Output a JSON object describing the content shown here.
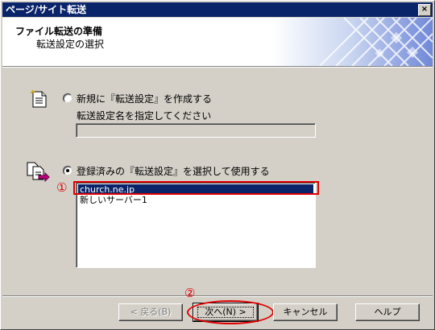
{
  "window": {
    "title": "ページ/サイト転送",
    "close_glyph": "×"
  },
  "header": {
    "title": "ファイル転送の準備",
    "subtitle": "転送設定の選択"
  },
  "option_new": {
    "label": "新規に『転送設定』を作成する",
    "field_label": "転送設定名を指定してください",
    "field_value": ""
  },
  "option_existing": {
    "label": "登録済みの『転送設定』を選択して使用する",
    "selected": true
  },
  "list": {
    "items": [
      "church.ne.jp",
      "新しいサーバー1"
    ],
    "selected_index": 0
  },
  "annotations": {
    "marker1": "①",
    "marker2": "②",
    "color": "#e00000"
  },
  "buttons": {
    "back": "< 戻る(B)",
    "next": "次へ(N) >",
    "cancel": "キャンセル",
    "help": "ヘルプ"
  },
  "colors": {
    "title_bar": "#0a246a",
    "selection": "#0a246a",
    "face": "#d4d0c8"
  },
  "icons": {
    "new": "document-icon",
    "existing": "documents-copy-icon"
  }
}
